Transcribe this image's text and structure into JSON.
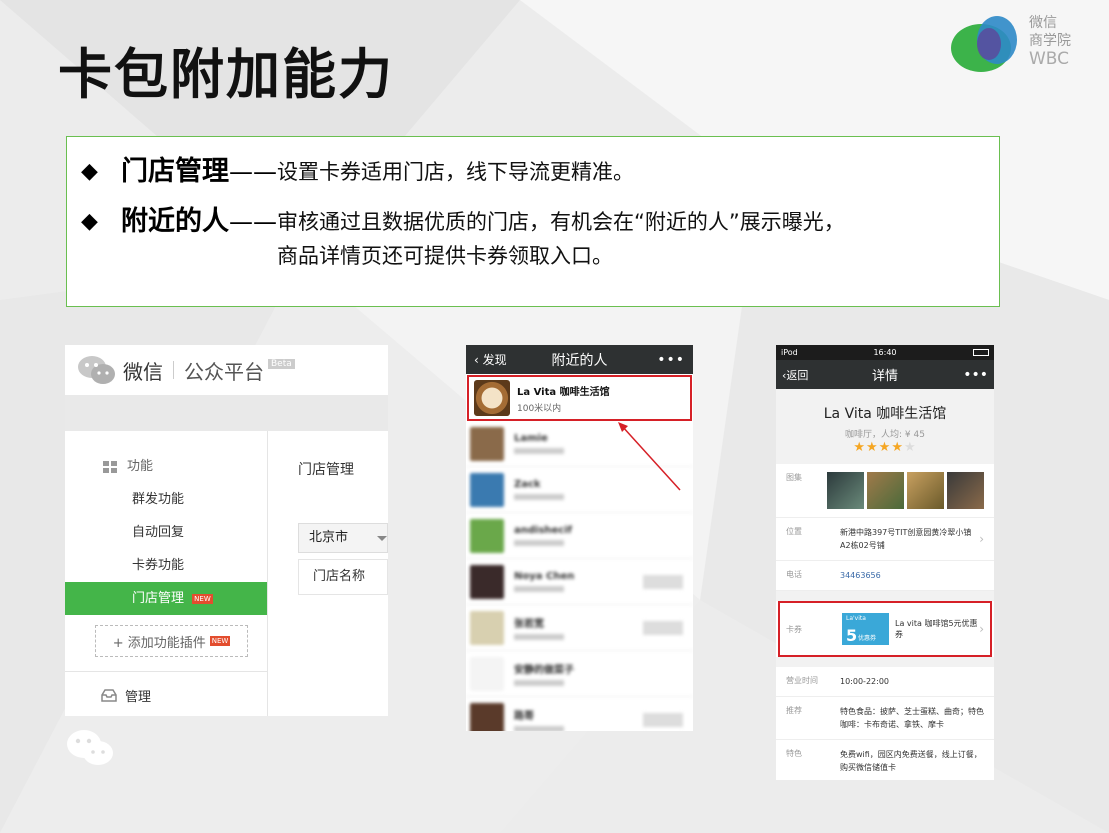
{
  "slide": {
    "title": "卡包附加能力",
    "logo": {
      "line1": "微信",
      "line2": "商学院",
      "line3": "WBC"
    }
  },
  "bullets": [
    {
      "head": "门店管理",
      "dash": "——",
      "body": "设置卡券适用门店，线下导流更精准。",
      "body2": ""
    },
    {
      "head": "附近的人",
      "dash": "——",
      "body": "审核通过且数据优质的门店，有机会在“附近的人”展示曝光，",
      "body2": "商品详情页还可提供卡券领取入口。"
    }
  ],
  "platform": {
    "brand": "微信",
    "name": "公众平台",
    "beta": "Beta",
    "category": "功能",
    "items": [
      "群发功能",
      "自动回复",
      "卡券功能"
    ],
    "active_item": "门店管理",
    "new_tag": "NEW",
    "add_plugin": "+ 添加功能插件",
    "manage": "管理",
    "main_title": "门店管理",
    "city": "北京市",
    "column": "门店名称"
  },
  "nearby": {
    "back": "发现",
    "title": "附近的人",
    "more": "•••",
    "top_name": "La Vita 咖啡生活馆",
    "top_dist": "100米以内",
    "rows": [
      "Lamie",
      "Zack",
      "andishecif",
      "Noya Chen",
      "张若宽",
      "安静的做菜子",
      "路哥"
    ]
  },
  "detail": {
    "status_left": "iPod",
    "status_time": "16:40",
    "back": "返回",
    "title": "详情",
    "more": "•••",
    "shop": "La Vita 咖啡生活馆",
    "meta": "咖啡厅，人均: ¥ 45",
    "rating": 4,
    "gallery_label": "图集",
    "location_label": "位置",
    "location": "新港中路397号TIT创意园黄冷翠小镇A2栋02号铺",
    "phone_label": "电话",
    "phone": "34463656",
    "coupon_label": "卡券",
    "coupon_brand": "La'vita",
    "coupon_value": "5",
    "coupon_tag": "优惠券",
    "coupon_text": "La vita 咖啡馆5元优惠券",
    "hours_label": "营业时间",
    "hours": "10:00-22:00",
    "recommend_label": "推荐",
    "recommend": "特色食品：披萨、芝士蛋糕、曲奇；特色咖啡：卡布奇诺、拿铁、摩卡",
    "feature_label": "特色",
    "feature": "免费wifi，园区内免费送餐，线上订餐，购买微信储值卡"
  },
  "colors": {
    "accent_green": "#44b549",
    "highlight_red": "#d62027",
    "border_green": "#6abf50"
  }
}
